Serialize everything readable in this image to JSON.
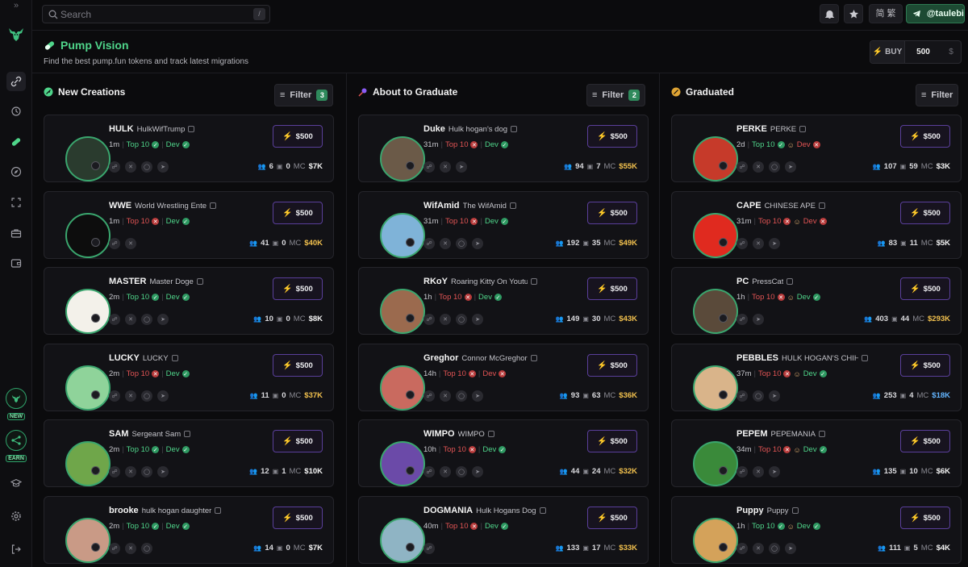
{
  "search": {
    "placeholder": "Search",
    "shortcut": "/"
  },
  "topbar": {
    "language_label": "简 繁",
    "user_handle": "@taulebi"
  },
  "header": {
    "title": "Pump Vision",
    "subtitle": "Find the best pump.fun tokens and track latest migrations",
    "buy_label": "BUY",
    "buy_amount": "500",
    "currency_symbol": "$"
  },
  "rail": {
    "badges": [
      "NEW",
      "EARN"
    ]
  },
  "columns": [
    {
      "title": "New Creations",
      "filter_label": "Filter",
      "filter_count": "3",
      "cards": [
        {
          "symbol": "HULK",
          "name": "HulkWifTrump",
          "age": "1m",
          "top10": "Top 10",
          "top10_ok": true,
          "dev": "Dev",
          "dev_ok": true,
          "dev_emoji": false,
          "holders": "6",
          "comments": "0",
          "mc_label": "MC",
          "mc": "$7K",
          "mc_color": "white",
          "buy": "$500",
          "avatar": "#2a3b2e"
        },
        {
          "symbol": "WWE",
          "name": "World Wrestling Ente",
          "age": "1m",
          "top10": "Top 10",
          "top10_ok": false,
          "dev": "Dev",
          "dev_ok": true,
          "dev_emoji": false,
          "holders": "41",
          "comments": "0",
          "mc_label": "MC",
          "mc": "$40K",
          "mc_color": "gold",
          "buy": "$500",
          "avatar": "#0d0d0d"
        },
        {
          "symbol": "MASTER",
          "name": "Master Doge",
          "age": "2m",
          "top10": "Top 10",
          "top10_ok": true,
          "dev": "Dev",
          "dev_ok": true,
          "dev_emoji": false,
          "holders": "10",
          "comments": "0",
          "mc_label": "MC",
          "mc": "$8K",
          "mc_color": "white",
          "buy": "$500",
          "avatar": "#f3f1ea"
        },
        {
          "symbol": "LUCKY",
          "name": "LUCKY",
          "age": "2m",
          "top10": "Top 10",
          "top10_ok": false,
          "dev": "Dev",
          "dev_ok": true,
          "dev_emoji": false,
          "holders": "11",
          "comments": "0",
          "mc_label": "MC",
          "mc": "$37K",
          "mc_color": "gold",
          "buy": "$500",
          "avatar": "#8fd39a"
        },
        {
          "symbol": "SAM",
          "name": "Sergeant Sam",
          "age": "2m",
          "top10": "Top 10",
          "top10_ok": true,
          "dev": "Dev",
          "dev_ok": true,
          "dev_emoji": false,
          "holders": "12",
          "comments": "1",
          "mc_label": "MC",
          "mc": "$10K",
          "mc_color": "white",
          "buy": "$500",
          "avatar": "#6fa64a"
        },
        {
          "symbol": "brooke",
          "name": "hulk hogan daughter",
          "age": "2m",
          "top10": "Top 10",
          "top10_ok": true,
          "dev": "Dev",
          "dev_ok": true,
          "dev_emoji": false,
          "holders": "14",
          "comments": "0",
          "mc_label": "MC",
          "mc": "$7K",
          "mc_color": "white",
          "buy": "$500",
          "avatar": "#c99a86"
        }
      ]
    },
    {
      "title": "About to Graduate",
      "filter_label": "Filter",
      "filter_count": "2",
      "cards": [
        {
          "symbol": "Duke",
          "name": "Hulk hogan's dog",
          "age": "31m",
          "top10": "Top 10",
          "top10_ok": false,
          "dev": "Dev",
          "dev_ok": true,
          "dev_emoji": false,
          "holders": "94",
          "comments": "7",
          "mc_label": "MC",
          "mc": "$55K",
          "mc_color": "gold",
          "buy": "$500",
          "avatar": "#6b5a48"
        },
        {
          "symbol": "WifAmid",
          "name": "The WifAmid",
          "age": "31m",
          "top10": "Top 10",
          "top10_ok": false,
          "dev": "Dev",
          "dev_ok": true,
          "dev_emoji": false,
          "holders": "192",
          "comments": "35",
          "mc_label": "MC",
          "mc": "$49K",
          "mc_color": "gold",
          "buy": "$500",
          "avatar": "#7fb3d8"
        },
        {
          "symbol": "RKoY",
          "name": "Roaring Kitty On Youtube",
          "age": "1h",
          "top10": "Top 10",
          "top10_ok": false,
          "dev": "Dev",
          "dev_ok": true,
          "dev_emoji": false,
          "holders": "149",
          "comments": "30",
          "mc_label": "MC",
          "mc": "$43K",
          "mc_color": "gold",
          "buy": "$500",
          "avatar": "#9b6a4e"
        },
        {
          "symbol": "Greghor",
          "name": "Connor McGreghor",
          "age": "14h",
          "top10": "Top 10",
          "top10_ok": false,
          "dev": "Dev",
          "dev_ok": false,
          "dev_emoji": false,
          "holders": "93",
          "comments": "63",
          "mc_label": "MC",
          "mc": "$36K",
          "mc_color": "gold",
          "buy": "$500",
          "avatar": "#c96a5f"
        },
        {
          "symbol": "WIMPO",
          "name": "WIMPO",
          "age": "10h",
          "top10": "Top 10",
          "top10_ok": false,
          "dev": "Dev",
          "dev_ok": true,
          "dev_emoji": false,
          "holders": "44",
          "comments": "24",
          "mc_label": "MC",
          "mc": "$32K",
          "mc_color": "gold",
          "buy": "$500",
          "avatar": "#6b4aa8"
        },
        {
          "symbol": "DOGMANIA",
          "name": "Hulk Hogans Dog",
          "age": "40m",
          "top10": "Top 10",
          "top10_ok": false,
          "dev": "Dev",
          "dev_ok": true,
          "dev_emoji": false,
          "holders": "133",
          "comments": "17",
          "mc_label": "MC",
          "mc": "$33K",
          "mc_color": "gold",
          "buy": "$500",
          "avatar": "#8fb4c4"
        }
      ]
    },
    {
      "title": "Graduated",
      "filter_label": "Filter",
      "filter_count": "",
      "cards": [
        {
          "symbol": "PERKE",
          "name": "PERKE",
          "age": "2d",
          "top10": "Top 10",
          "top10_ok": true,
          "dev": "Dev",
          "dev_ok": false,
          "dev_emoji": true,
          "holders": "107",
          "comments": "59",
          "mc_label": "MC",
          "mc": "$3K",
          "mc_color": "white",
          "buy": "$500",
          "avatar": "#c63a2a"
        },
        {
          "symbol": "CAPE",
          "name": "CHINESE APE",
          "age": "31m",
          "top10": "Top 10",
          "top10_ok": false,
          "dev": "Dev",
          "dev_ok": false,
          "dev_emoji": true,
          "holders": "83",
          "comments": "11",
          "mc_label": "MC",
          "mc": "$5K",
          "mc_color": "white",
          "buy": "$500",
          "avatar": "#e02a1f"
        },
        {
          "symbol": "PC",
          "name": "PressCat",
          "age": "1h",
          "top10": "Top 10",
          "top10_ok": false,
          "dev": "Dev",
          "dev_ok": true,
          "dev_emoji": true,
          "holders": "403",
          "comments": "44",
          "mc_label": "MC",
          "mc": "$293K",
          "mc_color": "gold",
          "buy": "$500",
          "avatar": "#5a4a3a"
        },
        {
          "symbol": "PEBBLES",
          "name": "HULK HOGAN'S CHIHUAH",
          "age": "37m",
          "top10": "Top 10",
          "top10_ok": false,
          "dev": "Dev",
          "dev_ok": true,
          "dev_emoji": true,
          "holders": "253",
          "comments": "4",
          "mc_label": "MC",
          "mc": "$18K",
          "mc_color": "blue",
          "buy": "$500",
          "avatar": "#d9b48a"
        },
        {
          "symbol": "PEPEM",
          "name": "PEPEMANIA",
          "age": "34m",
          "top10": "Top 10",
          "top10_ok": false,
          "dev": "Dev",
          "dev_ok": true,
          "dev_emoji": true,
          "holders": "135",
          "comments": "10",
          "mc_label": "MC",
          "mc": "$6K",
          "mc_color": "white",
          "buy": "$500",
          "avatar": "#3a8a3a"
        },
        {
          "symbol": "Puppy",
          "name": "Puppy",
          "age": "1h",
          "top10": "Top 10",
          "top10_ok": true,
          "dev": "Dev",
          "dev_ok": true,
          "dev_emoji": true,
          "holders": "111",
          "comments": "5",
          "mc_label": "MC",
          "mc": "$4K",
          "mc_color": "white",
          "buy": "$500",
          "avatar": "#d4a25a"
        }
      ]
    }
  ],
  "colors": {
    "accent": "#4fd58a",
    "danger": "#e25454",
    "gold": "#f2c14e",
    "buy_border": "#5a3f9a"
  }
}
